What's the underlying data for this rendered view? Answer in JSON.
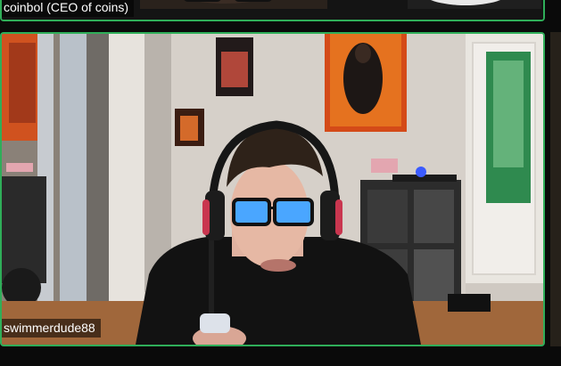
{
  "participants": [
    {
      "name": "coinbol (CEO of coins)",
      "speaking": true
    },
    {
      "name": "swimmerdude88",
      "speaking": true
    }
  ],
  "colors": {
    "speaking_border": "#2fae59",
    "background": "#0a0a0a"
  }
}
